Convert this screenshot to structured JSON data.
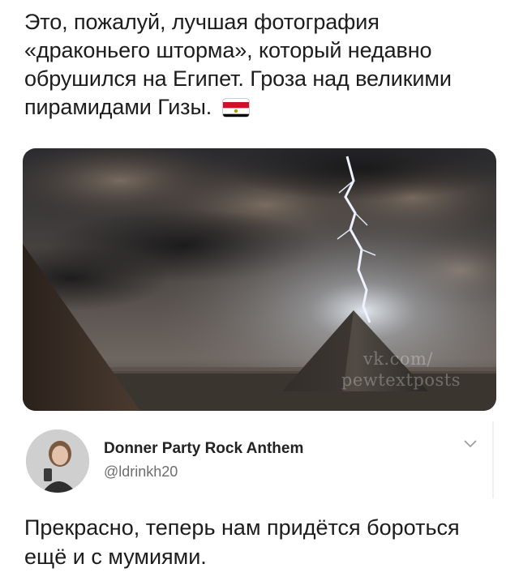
{
  "tweet": {
    "text": "Это, пожалуй, лучшая фотография «драконьего шторма», который недавно обрушился на Египет. Гроза над великими пирамидами Гизы.",
    "flag_icon": "egypt-flag-icon",
    "image": {
      "description_icon": "pyramids-lightning-photo",
      "watermark_line1": "vk.com/",
      "watermark_line2": "pewtextposts"
    }
  },
  "reply": {
    "author_name": "Donner Party Rock Anthem",
    "author_handle": "@ldrinkh20",
    "text": "Прекрасно, теперь нам придётся бороться ещё и с мумиями."
  },
  "colors": {
    "text": "#1c1c1c",
    "handle": "#6d6d6d",
    "flag_red": "#ce1126",
    "flag_black": "#000000"
  }
}
